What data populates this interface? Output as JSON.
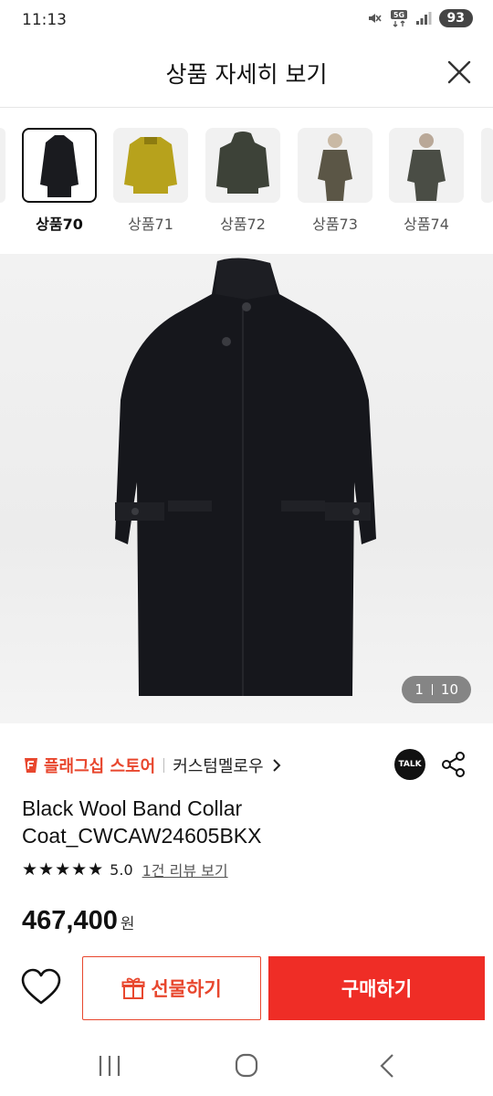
{
  "status": {
    "time": "11:13",
    "network": "5G",
    "battery": "93"
  },
  "header": {
    "title": "상품 자세히 보기",
    "close_icon": "close-icon"
  },
  "thumbnails": [
    {
      "label": "상품70",
      "selected": true,
      "color": "#1a1b1f"
    },
    {
      "label": "상품71",
      "selected": false,
      "color": "#b7a21c"
    },
    {
      "label": "상품72",
      "selected": false,
      "color": "#3d4238"
    },
    {
      "label": "상품73",
      "selected": false,
      "color": "#5b5646"
    },
    {
      "label": "상품74",
      "selected": false,
      "color": "#4a4d45"
    }
  ],
  "hero": {
    "current": "1",
    "total": "10"
  },
  "store": {
    "badge": "플래그십 스토어",
    "name": "커스텀멜로우",
    "talk_label": "TALK"
  },
  "product": {
    "title": "Black Wool Band Collar Coat_CWCAW24605BKX",
    "stars": "★★★★★",
    "rating": "5.0",
    "review_link": "1건 리뷰 보기",
    "price": "467,400",
    "currency": "원"
  },
  "actions": {
    "gift_label": "선물하기",
    "buy_label": "구매하기"
  },
  "colors": {
    "accent": "#ef2d26",
    "store_orange": "#e8472e"
  }
}
